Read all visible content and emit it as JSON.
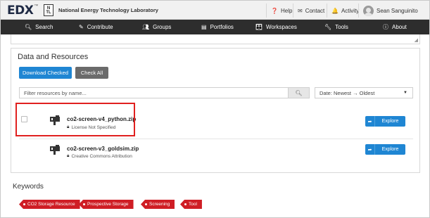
{
  "header": {
    "logo_text": "EDX",
    "logo_tm": "™",
    "netl_top": "N",
    "netl_bottom": "TL",
    "org_name": "National Energy Technology Laboratory",
    "help_label": "Help",
    "contact_label": "Contact",
    "activity_label": "Activity",
    "user_name": "Sean Sanguinito"
  },
  "nav": {
    "items": [
      {
        "label": "Search",
        "icon": "search-icon"
      },
      {
        "label": "Contribute",
        "icon": "edit-icon"
      },
      {
        "label": "Groups",
        "icon": "groups-icon"
      },
      {
        "label": "Portfolios",
        "icon": "portfolio-icon"
      },
      {
        "label": "Workspaces",
        "icon": "workspaces-icon"
      },
      {
        "label": "Tools",
        "icon": "wrench-icon"
      },
      {
        "label": "About",
        "icon": "info-icon"
      }
    ]
  },
  "resources": {
    "title": "Data and Resources",
    "download_label": "Download Checked",
    "check_all_label": "Check All",
    "filter_placeholder": "Filter resources by name...",
    "sort_value": "Date: Newest → Oldest",
    "items": [
      {
        "name": "co2-screen-v4_python.zip",
        "license": "License Not Specified",
        "explore_label": "Explore"
      },
      {
        "name": "co2-screen-v3_goldsim.zip",
        "license": "Creative Commons Attribution",
        "explore_label": "Explore"
      }
    ]
  },
  "keywords": {
    "title": "Keywords",
    "tags": [
      "CO2 Storage Resource",
      "Prospective Storage",
      "Screening",
      "Tool"
    ]
  },
  "colors": {
    "accent_blue": "#1f86d3",
    "nav_bg": "#2d2d2d",
    "tag_red": "#cf1e25",
    "highlight_red": "#e0201f"
  }
}
